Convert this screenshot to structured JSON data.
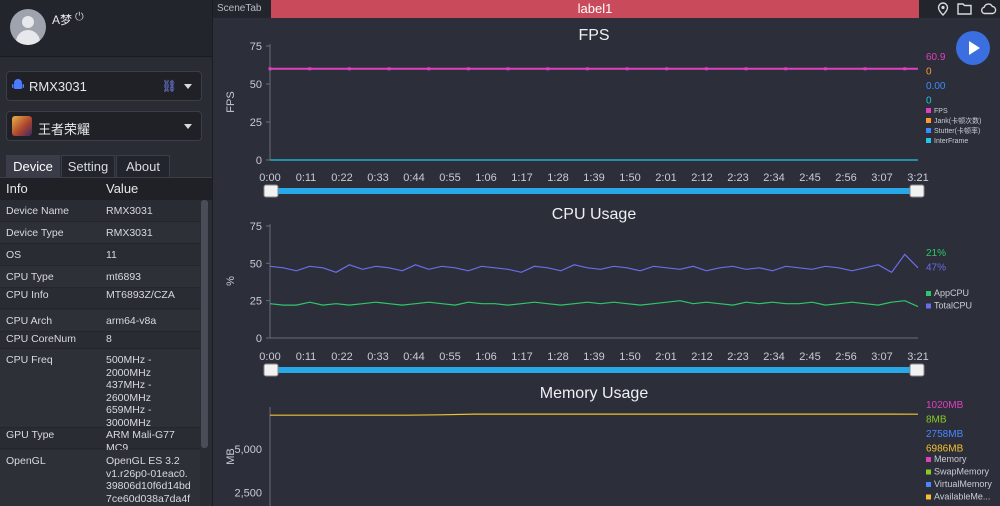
{
  "user": {
    "name": "A梦"
  },
  "device_select": {
    "value": "RMX3031"
  },
  "app_select": {
    "value": "王者荣耀"
  },
  "tabs": [
    "Device",
    "Setting",
    "About"
  ],
  "table": {
    "headers": [
      "Info",
      "Value"
    ],
    "rows": [
      {
        "k": "Device Name",
        "v": "RMX3031"
      },
      {
        "k": "Device Type",
        "v": "RMX3031"
      },
      {
        "k": "OS",
        "v": "11"
      },
      {
        "k": "CPU Type",
        "v": "mt6893"
      },
      {
        "k": "CPU Info",
        "v": "MT6893Z/CZA"
      },
      {
        "k": "CPU Arch",
        "v": "arm64-v8a"
      },
      {
        "k": "CPU CoreNum",
        "v": "8"
      },
      {
        "k": "CPU Freq",
        "v": "500MHz -\n2000MHz\n437MHz -\n2600MHz\n659MHz -\n3000MHz"
      },
      {
        "k": "GPU Type",
        "v": "ARM Mali-G77\nMC9"
      },
      {
        "k": "OpenGL",
        "v": "OpenGL ES 3.2\nv1.r26p0-01eac0.\n39806d10f6d14bd\n7ce60d038a7da4f\nF"
      }
    ]
  },
  "topbar": {
    "scene_tab": "SceneTab",
    "label": "label1"
  },
  "icons": [
    "android-icon",
    "link-icon",
    "power-icon",
    "location-icon",
    "folder-icon",
    "cloud-icon",
    "play-icon"
  ],
  "colors": {
    "fps": "#e040c0",
    "jank": "#ff9a2e",
    "stutter": "#3b8cff",
    "interframe": "#22c6e8",
    "app_cpu": "#2ec86a",
    "total_cpu": "#6a6ee8",
    "memory": "#e040c0",
    "swap": "#88cc22",
    "virtual": "#4a86ff",
    "available": "#f2c230",
    "slider": "#29a8e8"
  },
  "chart_data": [
    {
      "type": "line",
      "title": "FPS",
      "ylabel": "FPS",
      "xlabel": "",
      "ylim": [
        0,
        75
      ],
      "yticks": [
        "0",
        "25",
        "50",
        "75"
      ],
      "xticks": [
        "0:00",
        "0:11",
        "0:22",
        "0:33",
        "0:44",
        "0:55",
        "1:06",
        "1:17",
        "1:28",
        "1:39",
        "1:50",
        "2:01",
        "2:12",
        "2:23",
        "2:34",
        "2:45",
        "2:56",
        "3:07",
        "3:21"
      ],
      "x_range_seconds": [
        0,
        201
      ],
      "series": [
        {
          "name": "FPS",
          "values": [
            60,
            60,
            60,
            60,
            60,
            60,
            60,
            60,
            60,
            60,
            60,
            60,
            60,
            60,
            60,
            60,
            60,
            60,
            60,
            60,
            60,
            60,
            60,
            60,
            60,
            60,
            60,
            60,
            60,
            60,
            60,
            60,
            60,
            60,
            60,
            60,
            60,
            60,
            60,
            60,
            60,
            60,
            60,
            60,
            60,
            60,
            60,
            60,
            60,
            60
          ]
        },
        {
          "name": "Jank(卡顿次数)",
          "values": [
            0
          ]
        },
        {
          "name": "Stutter(卡顿率)",
          "values": [
            0
          ]
        },
        {
          "name": "InterFrame",
          "values": [
            0,
            0,
            0,
            0,
            0,
            0,
            0,
            0,
            0,
            0,
            0,
            0,
            0,
            0,
            0,
            0,
            0,
            0,
            0,
            0,
            0,
            0,
            0,
            0,
            0,
            0,
            0,
            0,
            0,
            0,
            0,
            0,
            0,
            0,
            0,
            0,
            0,
            0,
            0,
            0,
            0,
            0,
            0,
            0,
            0,
            0,
            0,
            0,
            0,
            0
          ]
        }
      ],
      "current": [
        "60.9",
        "0",
        "0.00",
        "0"
      ]
    },
    {
      "type": "line",
      "title": "CPU Usage",
      "ylabel": "%",
      "xlabel": "",
      "ylim": [
        0,
        75
      ],
      "yticks": [
        "0",
        "25",
        "50",
        "75"
      ],
      "xticks": [
        "0:00",
        "0:11",
        "0:22",
        "0:33",
        "0:44",
        "0:55",
        "1:06",
        "1:17",
        "1:28",
        "1:39",
        "1:50",
        "2:01",
        "2:12",
        "2:23",
        "2:34",
        "2:45",
        "2:56",
        "3:07",
        "3:21"
      ],
      "x_range_seconds": [
        0,
        201
      ],
      "series": [
        {
          "name": "AppCPU",
          "values": [
            23,
            22,
            22,
            24,
            22,
            23,
            22,
            23,
            24,
            23,
            22,
            23,
            24,
            23,
            22,
            24,
            23,
            23,
            22,
            23,
            24,
            23,
            22,
            23,
            24,
            23,
            24,
            23,
            22,
            23,
            24,
            25,
            23,
            24,
            23,
            22,
            24,
            23,
            24,
            23,
            23,
            24,
            22,
            23,
            24,
            23,
            22,
            24,
            25,
            21
          ]
        },
        {
          "name": "TotalCPU",
          "values": [
            48,
            47,
            45,
            48,
            47,
            44,
            49,
            46,
            48,
            47,
            45,
            49,
            46,
            48,
            47,
            45,
            48,
            47,
            46,
            44,
            48,
            47,
            45,
            49,
            47,
            46,
            48,
            47,
            45,
            48,
            47,
            46,
            48,
            45,
            47,
            48,
            46,
            47,
            45,
            48,
            47,
            46,
            48,
            47,
            45,
            47,
            49,
            44,
            56,
            47
          ]
        }
      ],
      "current": [
        "21%",
        "47%"
      ]
    },
    {
      "type": "line",
      "title": "Memory Usage",
      "ylabel": "MB",
      "xlabel": "",
      "yticks": [
        "2,500",
        "5,000"
      ],
      "series": [
        {
          "name": "Memory",
          "values": [
            1020,
            1020,
            1020,
            1020,
            1020,
            1020,
            1020,
            1020,
            1020,
            1020,
            1020,
            1020,
            1020,
            1020,
            1020,
            1020,
            1020,
            1020,
            1020,
            1020
          ]
        },
        {
          "name": "SwapMemory",
          "values": [
            8
          ]
        },
        {
          "name": "VirtualMemory",
          "values": [
            2758
          ]
        },
        {
          "name": "AvailableMe...",
          "values": [
            6930,
            6930,
            6930,
            6930,
            6930,
            6950,
            6990,
            6990,
            6990,
            6990,
            6990,
            6990,
            6990,
            6990,
            6990,
            6990,
            6990,
            6990,
            6990,
            6986
          ]
        }
      ],
      "current": [
        "1020MB",
        "8MB",
        "2758MB",
        "6986MB"
      ]
    }
  ]
}
